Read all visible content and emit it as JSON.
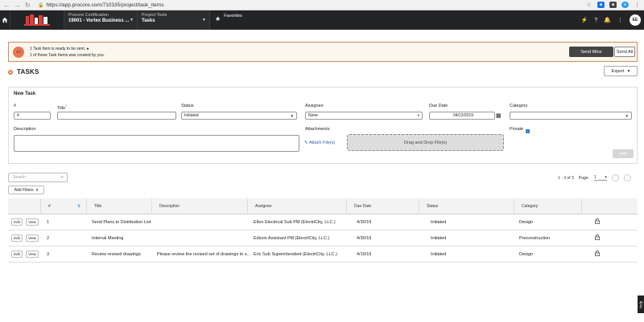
{
  "browser": {
    "url": "https://app.procore.com/710335/project/task_items"
  },
  "header": {
    "project_label": "Procore Certification",
    "project_name": "19001 - Vortex Business ...",
    "tools_label": "Project Tools",
    "tools_name": "Tasks",
    "favorites": "Favorites",
    "avatar": "EE"
  },
  "banner": {
    "line1": "1 Task Item is ready to be sent.",
    "line2": "1 of these Task Items was created by you.",
    "send_mine": "Send Mine",
    "send_all": "Send All"
  },
  "page": {
    "title": "TASKS",
    "export": "Export"
  },
  "form": {
    "title": "New Task",
    "number_label": "#",
    "number_value": "4",
    "title_label": "Title",
    "status_label": "Status",
    "status_value": "Initiated",
    "assignee_label": "Assignee",
    "assignee_value": "None",
    "due_label": "Due Date",
    "due_value": "04/12/2019",
    "category_label": "Category",
    "description_label": "Description",
    "attachments_label": "Attachments",
    "attach_link": "Attach File(s)",
    "drop_zone": "Drag and Drop File(s)",
    "private_label": "Private",
    "add_button": "Add"
  },
  "toolbar": {
    "search_placeholder": "Search",
    "add_filters": "Add Filters",
    "range": "1 - 3 of 3",
    "page_label": "Page:",
    "page_value": "1"
  },
  "table": {
    "headers": {
      "num": "#",
      "title": "Title",
      "description": "Description",
      "assignee": "Assignee",
      "due": "Due Date",
      "status": "Status",
      "category": "Category"
    },
    "edit": "Edit",
    "view": "View",
    "rows": [
      {
        "num": "1",
        "title": "Send Plans to Distribution List",
        "description": "",
        "assignee": "Elton Electrical Sub PM (ElectriCity, LLC.)",
        "due": "4/30/19",
        "status": "Initiated",
        "category": "Design"
      },
      {
        "num": "2",
        "title": "Internal Meeting",
        "description": "",
        "assignee": "Edison Assistant PM (ElectriCity, LLC.)",
        "due": "4/30/19",
        "status": "Initiated",
        "category": "Preconstruction"
      },
      {
        "num": "3",
        "title": "Review revised drawings",
        "description": "Please review the revised set of drawings to s...",
        "assignee": "Eric Sub Superintendent (ElectriCity, LLC.)",
        "due": "4/19/19",
        "status": "Initiated",
        "category": "Design"
      }
    ]
  },
  "help": "Help"
}
